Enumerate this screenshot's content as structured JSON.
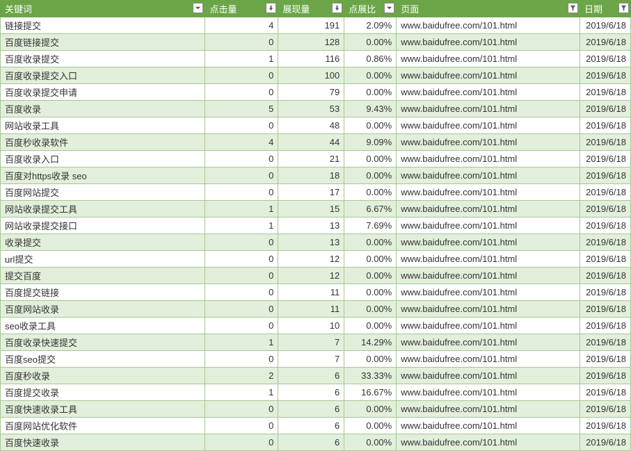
{
  "headers": {
    "keyword": "关键词",
    "clicks": "点击量",
    "impressions": "展现量",
    "ratio": "点展比",
    "page": "页面",
    "date": "日期"
  },
  "chart_data": {
    "type": "table",
    "title": "",
    "columns": [
      "关键词",
      "点击量",
      "展现量",
      "点展比",
      "页面",
      "日期"
    ],
    "rows": [
      {
        "keyword": "链接提交",
        "clicks": 4,
        "impressions": 191,
        "ratio": "2.09%",
        "page": "www.baidufree.com/101.html",
        "date": "2019/6/18"
      },
      {
        "keyword": "百度链接提交",
        "clicks": 0,
        "impressions": 128,
        "ratio": "0.00%",
        "page": "www.baidufree.com/101.html",
        "date": "2019/6/18"
      },
      {
        "keyword": "百度收录提交",
        "clicks": 1,
        "impressions": 116,
        "ratio": "0.86%",
        "page": "www.baidufree.com/101.html",
        "date": "2019/6/18"
      },
      {
        "keyword": "百度收录提交入口",
        "clicks": 0,
        "impressions": 100,
        "ratio": "0.00%",
        "page": "www.baidufree.com/101.html",
        "date": "2019/6/18"
      },
      {
        "keyword": "百度收录提交申请",
        "clicks": 0,
        "impressions": 79,
        "ratio": "0.00%",
        "page": "www.baidufree.com/101.html",
        "date": "2019/6/18"
      },
      {
        "keyword": "百度收录",
        "clicks": 5,
        "impressions": 53,
        "ratio": "9.43%",
        "page": "www.baidufree.com/101.html",
        "date": "2019/6/18"
      },
      {
        "keyword": "网站收录工具",
        "clicks": 0,
        "impressions": 48,
        "ratio": "0.00%",
        "page": "www.baidufree.com/101.html",
        "date": "2019/6/18"
      },
      {
        "keyword": "百度秒收录软件",
        "clicks": 4,
        "impressions": 44,
        "ratio": "9.09%",
        "page": "www.baidufree.com/101.html",
        "date": "2019/6/18"
      },
      {
        "keyword": "百度收录入口",
        "clicks": 0,
        "impressions": 21,
        "ratio": "0.00%",
        "page": "www.baidufree.com/101.html",
        "date": "2019/6/18"
      },
      {
        "keyword": "百度对https收录 seo",
        "clicks": 0,
        "impressions": 18,
        "ratio": "0.00%",
        "page": "www.baidufree.com/101.html",
        "date": "2019/6/18"
      },
      {
        "keyword": "百度网站提交",
        "clicks": 0,
        "impressions": 17,
        "ratio": "0.00%",
        "page": "www.baidufree.com/101.html",
        "date": "2019/6/18"
      },
      {
        "keyword": "网站收录提交工具",
        "clicks": 1,
        "impressions": 15,
        "ratio": "6.67%",
        "page": "www.baidufree.com/101.html",
        "date": "2019/6/18"
      },
      {
        "keyword": "网站收录提交接口",
        "clicks": 1,
        "impressions": 13,
        "ratio": "7.69%",
        "page": "www.baidufree.com/101.html",
        "date": "2019/6/18"
      },
      {
        "keyword": "收录提交",
        "clicks": 0,
        "impressions": 13,
        "ratio": "0.00%",
        "page": "www.baidufree.com/101.html",
        "date": "2019/6/18"
      },
      {
        "keyword": "url提交",
        "clicks": 0,
        "impressions": 12,
        "ratio": "0.00%",
        "page": "www.baidufree.com/101.html",
        "date": "2019/6/18"
      },
      {
        "keyword": "提交百度",
        "clicks": 0,
        "impressions": 12,
        "ratio": "0.00%",
        "page": "www.baidufree.com/101.html",
        "date": "2019/6/18"
      },
      {
        "keyword": "百度提交链接",
        "clicks": 0,
        "impressions": 11,
        "ratio": "0.00%",
        "page": "www.baidufree.com/101.html",
        "date": "2019/6/18"
      },
      {
        "keyword": "百度网站收录",
        "clicks": 0,
        "impressions": 11,
        "ratio": "0.00%",
        "page": "www.baidufree.com/101.html",
        "date": "2019/6/18"
      },
      {
        "keyword": "seo收录工具",
        "clicks": 0,
        "impressions": 10,
        "ratio": "0.00%",
        "page": "www.baidufree.com/101.html",
        "date": "2019/6/18"
      },
      {
        "keyword": "百度收录快速提交",
        "clicks": 1,
        "impressions": 7,
        "ratio": "14.29%",
        "page": "www.baidufree.com/101.html",
        "date": "2019/6/18"
      },
      {
        "keyword": "百度seo提交",
        "clicks": 0,
        "impressions": 7,
        "ratio": "0.00%",
        "page": "www.baidufree.com/101.html",
        "date": "2019/6/18"
      },
      {
        "keyword": "百度秒收录",
        "clicks": 2,
        "impressions": 6,
        "ratio": "33.33%",
        "page": "www.baidufree.com/101.html",
        "date": "2019/6/18"
      },
      {
        "keyword": "百度提交收录",
        "clicks": 1,
        "impressions": 6,
        "ratio": "16.67%",
        "page": "www.baidufree.com/101.html",
        "date": "2019/6/18"
      },
      {
        "keyword": "百度快速收录工具",
        "clicks": 0,
        "impressions": 6,
        "ratio": "0.00%",
        "page": "www.baidufree.com/101.html",
        "date": "2019/6/18"
      },
      {
        "keyword": "百度网站优化软件",
        "clicks": 0,
        "impressions": 6,
        "ratio": "0.00%",
        "page": "www.baidufree.com/101.html",
        "date": "2019/6/18"
      },
      {
        "keyword": "百度快速收录",
        "clicks": 0,
        "impressions": 6,
        "ratio": "0.00%",
        "page": "www.baidufree.com/101.html",
        "date": "2019/6/18"
      }
    ]
  }
}
